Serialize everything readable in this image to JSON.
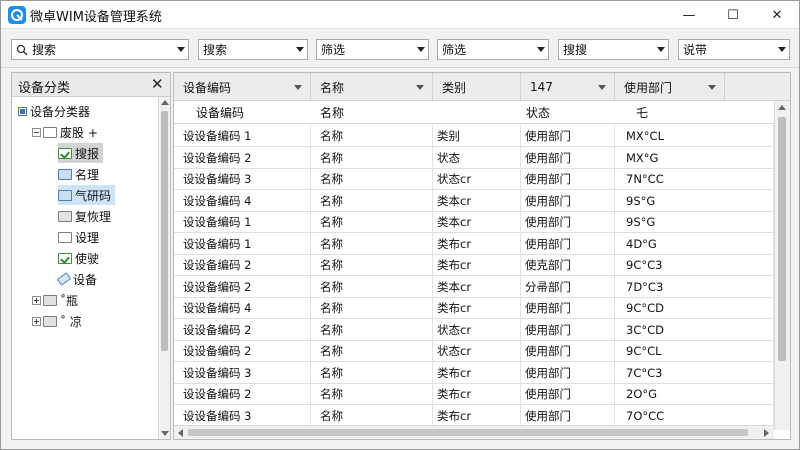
{
  "window": {
    "title": "微卓WIM设备管理系统",
    "accent": "#1f8fe6",
    "controls": {
      "minimize": "—",
      "maximize": "☐",
      "close": "✕"
    }
  },
  "toolbar": {
    "combos": [
      {
        "value": "搜索",
        "icon": "search-icon"
      },
      {
        "value": "搜索"
      },
      {
        "value": "筛选"
      },
      {
        "value": "筛选"
      },
      {
        "value": "搜搜"
      },
      {
        "value": "说带"
      }
    ]
  },
  "sidebar": {
    "title": "设备分类",
    "close": "✕",
    "nodes": [
      {
        "label": "设备分类器",
        "icon": "root-icon",
        "level": 0
      },
      {
        "label": "废股 +",
        "icon": "folder-icon",
        "level": 1,
        "expander": "minus"
      },
      {
        "label": "搜报",
        "icon": "folder-check-icon",
        "level": 2,
        "state": "selected"
      },
      {
        "label": "名理",
        "icon": "folder-blue-icon",
        "level": 2
      },
      {
        "label": "气研码",
        "icon": "folder-blue-icon",
        "level": 2,
        "state": "highlight"
      },
      {
        "label": "复恢理",
        "icon": "folder-gray-icon",
        "level": 2
      },
      {
        "label": "设理",
        "icon": "folder-icon",
        "level": 2
      },
      {
        "label": "使驶",
        "icon": "folder-check-icon",
        "level": 2
      },
      {
        "label": "设备",
        "icon": "tag-icon",
        "level": 2
      },
      {
        "label": "˚瓶",
        "icon": "folder-gray-icon",
        "level": 1,
        "expander": "plus"
      },
      {
        "label": "˚ 凉",
        "icon": "folder-gray-icon",
        "level": 1,
        "expander": "plus"
      }
    ]
  },
  "grid": {
    "header": [
      "设备编码",
      "名称",
      "类别",
      "147",
      "使用部门"
    ],
    "subheader": [
      "设备编码",
      "名称",
      "",
      "状态",
      "乇"
    ],
    "rows": [
      [
        "设设备编码 1",
        "名称",
        "类别",
        "使用部门",
        "MX°CL"
      ],
      [
        "设设备编码 2",
        "名称",
        "状态",
        "使用部门",
        "MX°G"
      ],
      [
        "设设备编码 3",
        "名称",
        "状态cr",
        "使用部门",
        "7N°CC"
      ],
      [
        "设设备编码 4",
        "名称",
        "类本cr",
        "使用部门",
        "9S°G"
      ],
      [
        "设设备编码 1",
        "名称",
        "类本cr",
        "使用部门",
        "9S°G"
      ],
      [
        "设设备编码 1",
        "名称",
        "类布cr",
        "使用部门",
        "4D°G"
      ],
      [
        "设设备编码 2",
        "名称",
        "类布cr",
        "使克部门",
        "9C°C3"
      ],
      [
        "设设备编码 2",
        "名称",
        "类本cr",
        "分帚部门",
        "7D°C3"
      ],
      [
        "设设备编码 4",
        "名称",
        "类布cr",
        "使用部门",
        "9C°CD"
      ],
      [
        "设设备编码 2",
        "名称",
        "状态cr",
        "使用部门",
        "3C°CD"
      ],
      [
        "设设备编码 2",
        "名称",
        "状态cr",
        "使用部门",
        "9C°CL"
      ],
      [
        "设设备编码 3",
        "名称",
        "类布cr",
        "使用部门",
        "7C°C3"
      ],
      [
        "设设备编码 2",
        "名称",
        "类布cr",
        "使用部门",
        "2O°G"
      ],
      [
        "设设备编码 3",
        "名称",
        "类布cr",
        "使用部门",
        "7O°CC"
      ]
    ]
  }
}
